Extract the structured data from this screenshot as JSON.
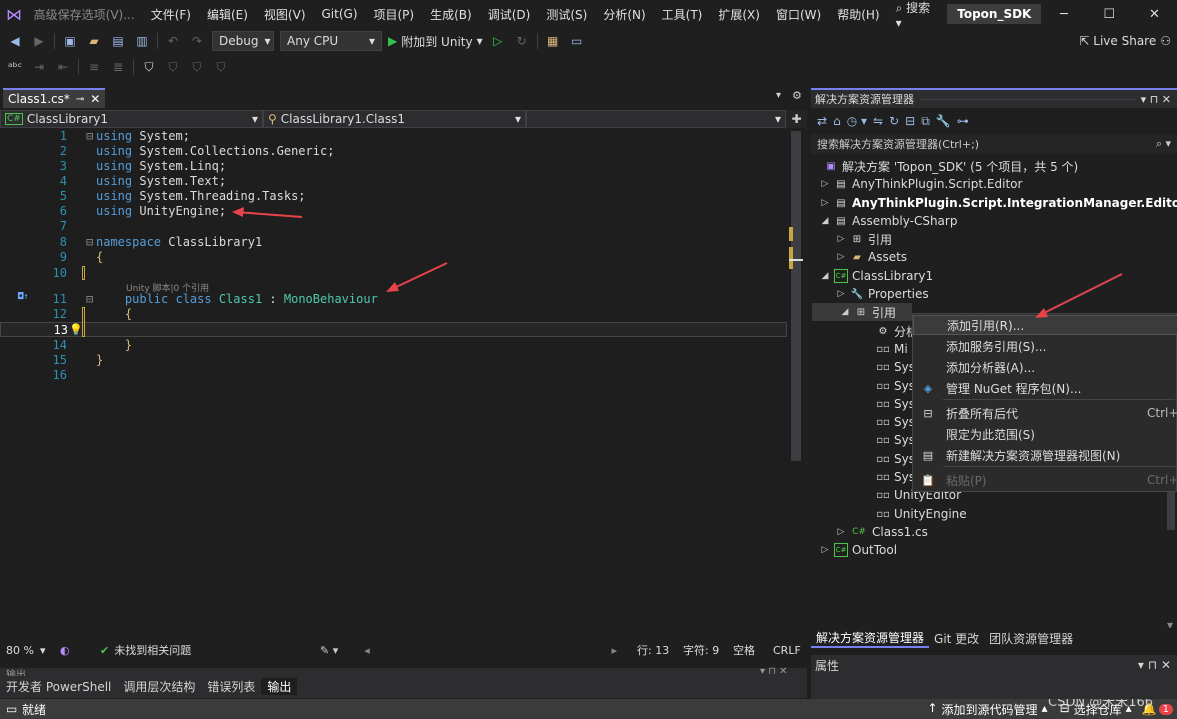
{
  "titlebar": {
    "menus": [
      "高级保存选项(V)...",
      "文件(F)",
      "编辑(E)",
      "视图(V)",
      "Git(G)",
      "项目(P)",
      "生成(B)",
      "调试(D)",
      "测试(S)",
      "分析(N)",
      "工具(T)",
      "扩展(X)",
      "窗口(W)",
      "帮助(H)"
    ],
    "search_label": "搜索",
    "solution_name": "Topon_SDK",
    "minimize": "─",
    "maximize": "☐",
    "close": "✕"
  },
  "toolbar": {
    "config": "Debug",
    "platform": "Any CPU",
    "attach_label": "附加到 Unity",
    "live_share": "Live Share"
  },
  "editor": {
    "tab_label": "Class1.cs*",
    "nav_left": "ClassLibrary1",
    "nav_mid": "ClassLibrary1.Class1",
    "codelens": "Unity 脚本|0 个引用",
    "line_numbers": [
      "1",
      "2",
      "3",
      "4",
      "5",
      "6",
      "7",
      "8",
      "9",
      "10",
      "11",
      "12",
      "13",
      "14",
      "15",
      "16"
    ],
    "lines": [
      [
        {
          "t": "using",
          "c": "kw"
        },
        {
          "t": " System;",
          "c": "id"
        }
      ],
      [
        {
          "t": "using",
          "c": "kw"
        },
        {
          "t": " System.Collections.Generic;",
          "c": "id"
        }
      ],
      [
        {
          "t": "using",
          "c": "kw"
        },
        {
          "t": " System.Linq;",
          "c": "id"
        }
      ],
      [
        {
          "t": "using",
          "c": "kw"
        },
        {
          "t": " System.Text;",
          "c": "id"
        }
      ],
      [
        {
          "t": "using",
          "c": "kw"
        },
        {
          "t": " System.Threading.Tasks;",
          "c": "id"
        }
      ],
      [
        {
          "t": "using",
          "c": "kw"
        },
        {
          "t": " UnityEngine;",
          "c": "id"
        }
      ],
      [],
      [
        {
          "t": "namespace",
          "c": "kw"
        },
        {
          "t": " ClassLibrary1",
          "c": "id"
        }
      ],
      [
        {
          "t": "{",
          "c": "brace"
        }
      ],
      [],
      [
        {
          "t": "    public",
          "c": "kw"
        },
        {
          "t": " class",
          "c": "kw"
        },
        {
          "t": " Class1",
          "c": "ty"
        },
        {
          "t": " : ",
          "c": "pn"
        },
        {
          "t": "MonoBehaviour",
          "c": "ty"
        }
      ],
      [
        {
          "t": "    {",
          "c": "brace"
        }
      ],
      [],
      [
        {
          "t": "    }",
          "c": "brace"
        }
      ],
      [
        {
          "t": "}",
          "c": "brace"
        }
      ],
      []
    ]
  },
  "status": {
    "zoom": "80 %",
    "issues": "未找到相关问题",
    "row": "行: 13",
    "col": "字符: 9",
    "spaces": "空格",
    "eol": "CRLF"
  },
  "bottom_tabs": [
    "开发者 PowerShell",
    "调用层次结构",
    "错误列表",
    "输出"
  ],
  "bottom_panel_title": "输出",
  "statusbar": {
    "ready": "就绪",
    "add_source": "添加到源代码管理",
    "select_repo": "选择仓库",
    "watermark": "CSDN @宋宋166",
    "notifications": "1"
  },
  "solution_explorer": {
    "title": "解决方案资源管理器",
    "search_placeholder": "搜索解决方案资源管理器(Ctrl+;)",
    "nodes": [
      "解决方案 'Topon_SDK' (5 个项目，共 5 个)",
      "AnyThinkPlugin.Script.Editor",
      "AnyThinkPlugin.Script.IntegrationManager.Editor",
      "Assembly-CSharp",
      "引用",
      "Assets",
      "ClassLibrary1",
      "Properties",
      "引用",
      "分析",
      "Mi",
      "Sys",
      "Sys",
      "Sys",
      "Sys",
      "Sys",
      "Sys",
      "Sys",
      "UnityEditor",
      "UnityEngine",
      "Class1.cs",
      "OutTool"
    ],
    "tabs": [
      "解决方案资源管理器",
      "Git 更改",
      "团队资源管理器"
    ],
    "properties_title": "属性"
  },
  "context_menu": {
    "items": [
      {
        "label": "添加引用(R)...",
        "shortcut": ""
      },
      {
        "label": "添加服务引用(S)...",
        "shortcut": ""
      },
      {
        "label": "添加分析器(A)...",
        "shortcut": ""
      },
      {
        "label": "管理 NuGet 程序包(N)...",
        "shortcut": ""
      },
      {
        "label": "折叠所有后代",
        "shortcut": "Ctrl+"
      },
      {
        "label": "限定为此范围(S)",
        "shortcut": ""
      },
      {
        "label": "新建解决方案资源管理器视图(N)",
        "shortcut": ""
      },
      {
        "label": "粘贴(P)",
        "shortcut": "Ctrl+V"
      }
    ]
  },
  "colors": {
    "accent": "#7a7ff0",
    "arrow": "#e8434b"
  }
}
